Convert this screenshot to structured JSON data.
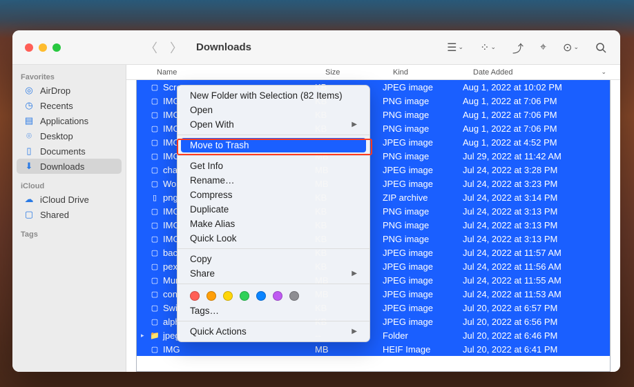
{
  "window": {
    "title": "Downloads"
  },
  "columns": {
    "name": "Name",
    "size": "Size",
    "kind": "Kind",
    "date": "Date Added"
  },
  "sidebar": {
    "sections": [
      {
        "title": "Favorites",
        "items": [
          {
            "icon": "airdrop",
            "label": "AirDrop"
          },
          {
            "icon": "recents",
            "label": "Recents"
          },
          {
            "icon": "apps",
            "label": "Applications"
          },
          {
            "icon": "desktop",
            "label": "Desktop"
          },
          {
            "icon": "docs",
            "label": "Documents"
          },
          {
            "icon": "downloads",
            "label": "Downloads",
            "selected": true
          }
        ]
      },
      {
        "title": "iCloud",
        "items": [
          {
            "icon": "icloud",
            "label": "iCloud Drive"
          },
          {
            "icon": "shared",
            "label": "Shared"
          }
        ]
      },
      {
        "title": "Tags",
        "items": []
      }
    ]
  },
  "files": [
    {
      "icon": "img",
      "name": "Scre",
      "size": "KB",
      "kind": "JPEG image",
      "date": "Aug 1, 2022 at 10:02 PM"
    },
    {
      "icon": "img",
      "name": "IMG",
      "size": "KB",
      "kind": "PNG image",
      "date": "Aug 1, 2022 at 7:06 PM"
    },
    {
      "icon": "img",
      "name": "IMG",
      "size": "KB",
      "kind": "PNG image",
      "date": "Aug 1, 2022 at 7:06 PM"
    },
    {
      "icon": "img",
      "name": "IMG",
      "size": "KB",
      "kind": "PNG image",
      "date": "Aug 1, 2022 at 7:06 PM"
    },
    {
      "icon": "img",
      "name": "IMG",
      "size": "MB",
      "kind": "JPEG image",
      "date": "Aug 1, 2022 at 4:52 PM"
    },
    {
      "icon": "img",
      "name": "IMG",
      "size": "MB",
      "kind": "PNG image",
      "date": "Jul 29, 2022 at 11:42 AM"
    },
    {
      "icon": "img",
      "name": "char",
      "size": "MB",
      "kind": "JPEG image",
      "date": "Jul 24, 2022 at 3:28 PM"
    },
    {
      "icon": "img",
      "name": "Wor",
      "size": "MB",
      "kind": "JPEG image",
      "date": "Jul 24, 2022 at 3:23 PM"
    },
    {
      "icon": "doc",
      "name": "png",
      "size": "KB",
      "kind": "ZIP archive",
      "date": "Jul 24, 2022 at 3:14 PM"
    },
    {
      "icon": "img",
      "name": "IMG",
      "size": "KB",
      "kind": "PNG image",
      "date": "Jul 24, 2022 at 3:13 PM"
    },
    {
      "icon": "img",
      "name": "IMG",
      "size": "KB",
      "kind": "PNG image",
      "date": "Jul 24, 2022 at 3:13 PM"
    },
    {
      "icon": "img",
      "name": "IMG",
      "size": "KB",
      "kind": "PNG image",
      "date": "Jul 24, 2022 at 3:13 PM"
    },
    {
      "icon": "img",
      "name": "bacl",
      "size": "KB",
      "kind": "JPEG image",
      "date": "Jul 24, 2022 at 11:57 AM"
    },
    {
      "icon": "img",
      "name": "pex",
      "size": "KB",
      "kind": "JPEG image",
      "date": "Jul 24, 2022 at 11:56 AM"
    },
    {
      "icon": "img",
      "name": "Mur",
      "size": "MB",
      "kind": "JPEG image",
      "date": "Jul 24, 2022 at 11:55 AM"
    },
    {
      "icon": "img",
      "name": "con",
      "size": "MB",
      "kind": "JPEG image",
      "date": "Jul 24, 2022 at 11:53 AM"
    },
    {
      "icon": "img",
      "name": "Swit",
      "size": "KB",
      "kind": "JPEG image",
      "date": "Jul 20, 2022 at 6:57 PM"
    },
    {
      "icon": "img",
      "name": "alph",
      "size": "KB",
      "kind": "JPEG image",
      "date": "Jul 20, 2022 at 6:56 PM"
    },
    {
      "icon": "folder",
      "name": "jpeg",
      "size": "--",
      "kind": "Folder",
      "date": "Jul 20, 2022 at 6:46 PM",
      "disclosure": true
    },
    {
      "icon": "img",
      "name": "IMG",
      "size": "MB",
      "kind": "HEIF Image",
      "date": "Jul 20, 2022 at 6:41 PM"
    }
  ],
  "context_menu": {
    "items": [
      {
        "type": "item",
        "label": "New Folder with Selection (82 Items)"
      },
      {
        "type": "item",
        "label": "Open"
      },
      {
        "type": "item",
        "label": "Open With",
        "submenu": true
      },
      {
        "type": "sep"
      },
      {
        "type": "item",
        "label": "Move to Trash",
        "highlighted": true
      },
      {
        "type": "sep"
      },
      {
        "type": "item",
        "label": "Get Info"
      },
      {
        "type": "item",
        "label": "Rename…"
      },
      {
        "type": "item",
        "label": "Compress"
      },
      {
        "type": "item",
        "label": "Duplicate"
      },
      {
        "type": "item",
        "label": "Make Alias"
      },
      {
        "type": "item",
        "label": "Quick Look"
      },
      {
        "type": "sep"
      },
      {
        "type": "item",
        "label": "Copy"
      },
      {
        "type": "item",
        "label": "Share",
        "submenu": true
      },
      {
        "type": "sep"
      },
      {
        "type": "tags"
      },
      {
        "type": "item",
        "label": "Tags…"
      },
      {
        "type": "sep"
      },
      {
        "type": "item",
        "label": "Quick Actions",
        "submenu": true
      }
    ],
    "tag_colors": [
      "#ff5f57",
      "#ff9f0a",
      "#ffd60a",
      "#30d158",
      "#0a84ff",
      "#bf5af2",
      "#8e8e93"
    ]
  },
  "sidebar_icons": {
    "airdrop": "◎",
    "recents": "◷",
    "apps": "▤",
    "desktop": "⌾",
    "docs": "▯",
    "downloads": "⬇",
    "icloud": "☁",
    "shared": "▢"
  }
}
